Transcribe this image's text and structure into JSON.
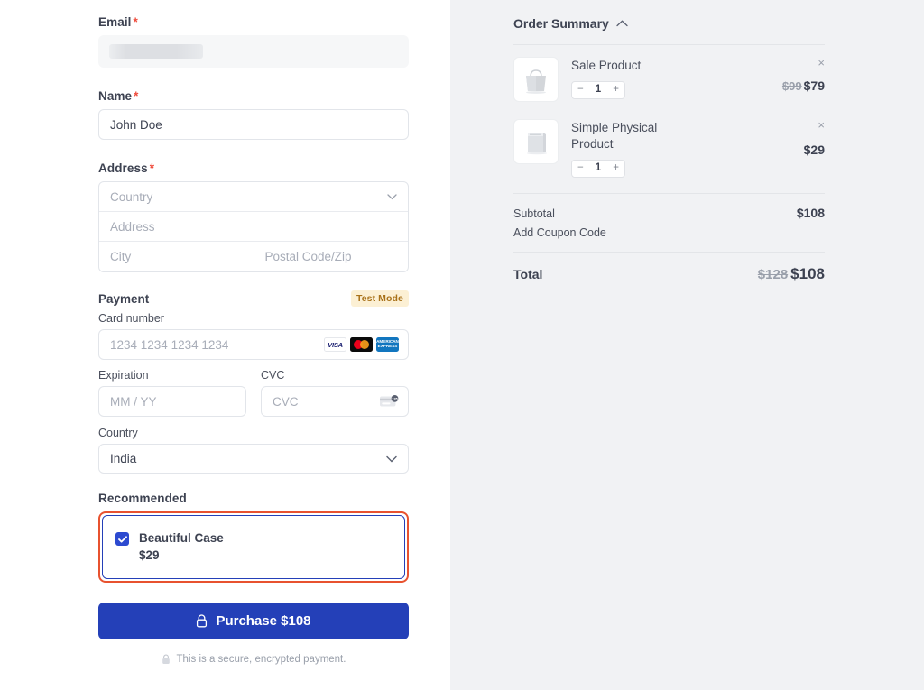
{
  "form": {
    "email": {
      "label": "Email",
      "required": true,
      "state": "loading",
      "value": ""
    },
    "name": {
      "label": "Name",
      "required": true,
      "value": "John Doe"
    },
    "address": {
      "label": "Address",
      "required": true,
      "country_placeholder": "Country",
      "street_placeholder": "Address",
      "city_placeholder": "City",
      "postal_placeholder": "Postal Code/Zip"
    },
    "payment": {
      "title": "Payment",
      "badge": "Test Mode",
      "card_number_label": "Card number",
      "card_number_placeholder": "1234 1234 1234 1234",
      "brands": [
        "visa",
        "mastercard",
        "amex"
      ],
      "expiration_label": "Expiration",
      "expiration_placeholder": "MM / YY",
      "cvc_label": "CVC",
      "cvc_placeholder": "CVC",
      "cvc_hint_number": "135",
      "country_label": "Country",
      "country_value": "India"
    },
    "recommended": {
      "label": "Recommended",
      "checked": true,
      "name": "Beautiful Case",
      "price": "$29",
      "highlight_color": "#e8522f",
      "box_border_color": "#2440b8"
    },
    "purchase_button": {
      "label": "Purchase $108",
      "icon": "lock-icon",
      "color": "#2440b8"
    },
    "secure_note": "This is a secure, encrypted payment."
  },
  "summary": {
    "title": "Order Summary",
    "collapse_icon": "chevron-up-icon",
    "items": [
      {
        "name": "Sale Product",
        "thumbnail": "tote-bag",
        "quantity": "1",
        "original_price": "$99",
        "price": "$79",
        "remove_label": "×"
      },
      {
        "name": "Simple Physical Product",
        "thumbnail": "box-package",
        "quantity": "1",
        "original_price": "",
        "price": "$29",
        "remove_label": "×"
      }
    ],
    "subtotal_label": "Subtotal",
    "subtotal_value": "$108",
    "coupon_label": "Add Coupon Code",
    "total_label": "Total",
    "total_original": "$128",
    "total_value": "$108"
  },
  "annotation": {
    "type": "arrow",
    "direction": "left",
    "color": "#f26b43",
    "target": "Simple Physical Product"
  },
  "stepper": {
    "minus": "−",
    "plus": "+"
  }
}
